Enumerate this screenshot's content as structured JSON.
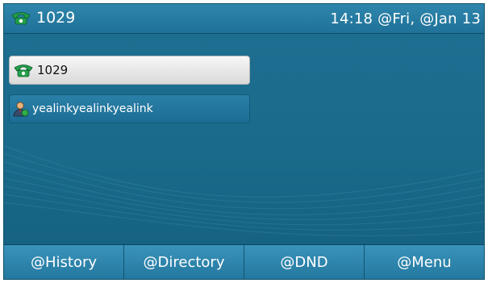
{
  "status": {
    "account": "1029",
    "datetime": "14:18 @Fri, @Jan 13",
    "account_icon": "phone-icon"
  },
  "line_keys": [
    {
      "label": "1029",
      "icon": "phone-icon",
      "state": "selected"
    },
    {
      "label": "yealinkyealinkyealink",
      "icon": "contact-icon",
      "state": "normal"
    }
  ],
  "softkeys": [
    {
      "label": "@History"
    },
    {
      "label": "@Directory"
    },
    {
      "label": "@DND"
    },
    {
      "label": "@Menu"
    }
  ],
  "colors": {
    "background": "#1a6a8b",
    "statusbar": "#2e86ac",
    "phone_icon": "#22a04a",
    "softkey": "#2e86ac"
  }
}
